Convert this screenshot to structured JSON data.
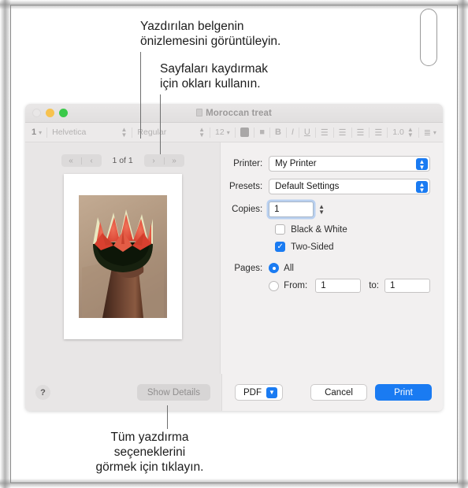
{
  "callouts": {
    "top": "Yazdırılan belgenin\nönizlemesini görüntüleyin.",
    "middle": "Sayfaları kaydırmak\niçin okları kullanın.",
    "bottom": "Tüm yazdırma\nseçeneklerini\ngörmek için tıklayın."
  },
  "window": {
    "title": "Moroccan treat",
    "traffic": {
      "close": "close-button",
      "minimize": "minimize-button",
      "zoom": "zoom-button"
    }
  },
  "format_bar": {
    "list_number": "1",
    "font_family": "Helvetica",
    "font_style": "Regular",
    "font_size": "12",
    "bold": "B",
    "italic": "I",
    "underline": "U",
    "line_spacing": "1.0"
  },
  "preview": {
    "page_label": "1 of 1",
    "prev_all": "«",
    "prev": "‹",
    "next": "›",
    "next_all": "»",
    "image_alt": "hand holding star-cut watermelon"
  },
  "print_options": {
    "printer_label": "Printer:",
    "printer_value": "My Printer",
    "presets_label": "Presets:",
    "presets_value": "Default Settings",
    "copies_label": "Copies:",
    "copies_value": "1",
    "black_white_label": "Black & White",
    "black_white_checked": false,
    "two_sided_label": "Two-Sided",
    "two_sided_checked": true,
    "pages_label": "Pages:",
    "pages_all_label": "All",
    "pages_all_selected": true,
    "pages_from_label": "From:",
    "pages_from_value": "1",
    "pages_to_label": "to:",
    "pages_to_value": "1"
  },
  "buttons": {
    "help": "?",
    "show_details": "Show Details",
    "pdf": "PDF",
    "cancel": "Cancel",
    "print": "Print"
  },
  "colors": {
    "accent_blue": "#1a7bf2",
    "window_chrome": "#eceaea",
    "sheet_left": "#e8e6e6",
    "sheet_right": "#f2f0f0"
  }
}
